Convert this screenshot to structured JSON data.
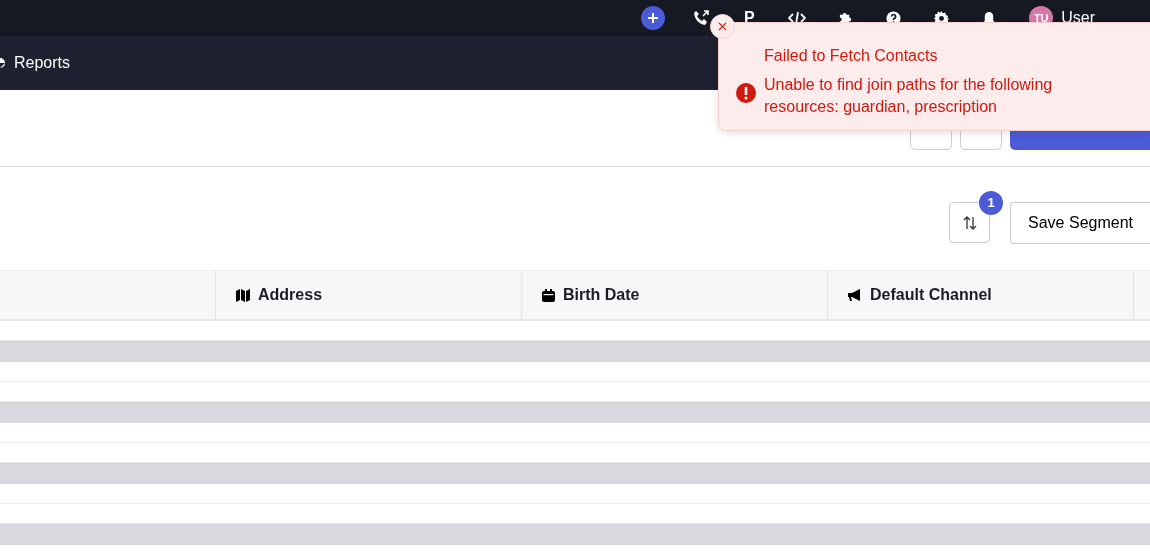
{
  "topbar": {
    "brand_letter": "P",
    "avatar_initials": "TU",
    "user": "User"
  },
  "nav": {
    "item": "Reports"
  },
  "toolbar": {
    "sort_count": "1",
    "save_button": "Save Segment"
  },
  "table": {
    "columns": [
      "Address",
      "Birth Date",
      "Default Channel"
    ],
    "rows": [
      {
        "kind": "blank"
      },
      {
        "kind": "skeleton"
      },
      {
        "kind": "blank"
      },
      {
        "kind": "blank"
      },
      {
        "kind": "skeleton"
      },
      {
        "kind": "blank"
      },
      {
        "kind": "blank"
      },
      {
        "kind": "skeleton"
      },
      {
        "kind": "blank"
      },
      {
        "kind": "blank"
      },
      {
        "kind": "skeleton"
      }
    ]
  },
  "toast": {
    "title": "Failed to Fetch Contacts",
    "message": "Unable to find join paths for the following resources: guardian, prescription"
  }
}
